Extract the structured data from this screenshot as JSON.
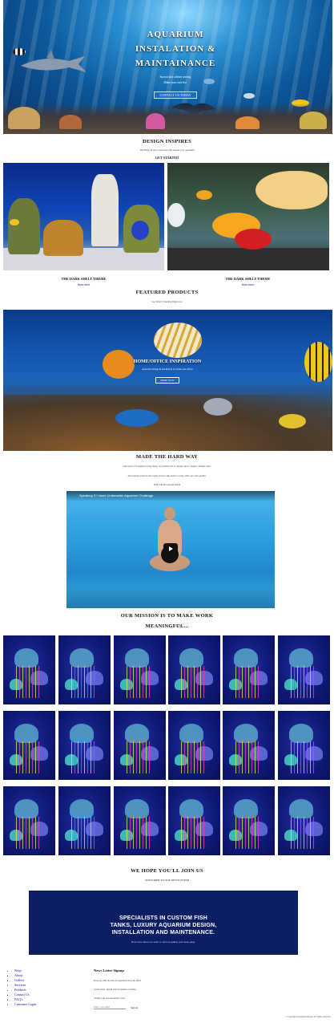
{
  "hero": {
    "title_line1": "AQUARIUM",
    "title_line2": "INSTALATION &",
    "title_line3": "MAINTAINANCE",
    "subtitle1": "Surreal and cabinet setting.",
    "subtitle2": "Make your own list.",
    "button_label": "CONTACT US TODAY"
  },
  "design": {
    "title": "DESIGN INSPIRES",
    "subtitle": "The Home & most vivid and with elegant your aquarium",
    "link_label": "GET STARTED"
  },
  "tanks": [
    {
      "caption": "THE DARK SHELF THEME",
      "link": "learn more"
    },
    {
      "caption": "THE DARK SHELF THEME",
      "link": "learn more"
    }
  ],
  "featured": {
    "title": "FEATURED PRODUCTS",
    "subtitle": "See What's Trending Right now",
    "banner_title": "HOME/OFFICE INSPIRATION",
    "banner_sub": "Aquarium design & installation for home and offices",
    "banner_button": "SHOP NOW"
  },
  "hard_way": {
    "title": "MADE THE HARD WAY",
    "line1": "Our team of designers bring many of products fit to design and to make a unique tank.",
    "line2": "All custom work by the team. Every tank built to order with care and quality.",
    "line3": "Fish Life & Custom Made"
  },
  "video": {
    "title": "Speaking 3+ hours Underwater Aquarium Challenge"
  },
  "mission": {
    "title_line1": "OUR MISSION IS TO MAKE WORK",
    "title_line2": "MEANINGFUL..."
  },
  "join": {
    "title": "WE HOPE YOU'LL JOIN US",
    "link": "SUBSCRIBE TO OUR NEWSLETTER"
  },
  "banner": {
    "line1": "SPECIALISTS IN CUSTOM FISH",
    "line2": "TANKS, LUXURY AQUARIUM DESIGN,",
    "line3": "INSTALLATION AND MAINTENANCE.",
    "sub": "Find more about our work or visit our gallery and news page."
  },
  "footer": {
    "nav": [
      "Shop",
      "About",
      "Gallery",
      "Services",
      "Products",
      "Contact Us",
      "FAQ's",
      "Customer Login"
    ],
    "newsletter_title": "News Letter Signup",
    "newsletter_p1": "Keep up with the best in aquarium news & offers",
    "newsletter_p2": "Latest ideas, tips & arrival updates on items",
    "newsletter_p3": "Simply join our newsletter today",
    "email_placeholder": "Enter your email",
    "signup_label": "Sign up",
    "copyright": "© Copyright Aquarium Design. All rights reserved."
  },
  "colors": {
    "banner_bg": "#0b1e63",
    "hero_blue": "#0d5a9c"
  }
}
